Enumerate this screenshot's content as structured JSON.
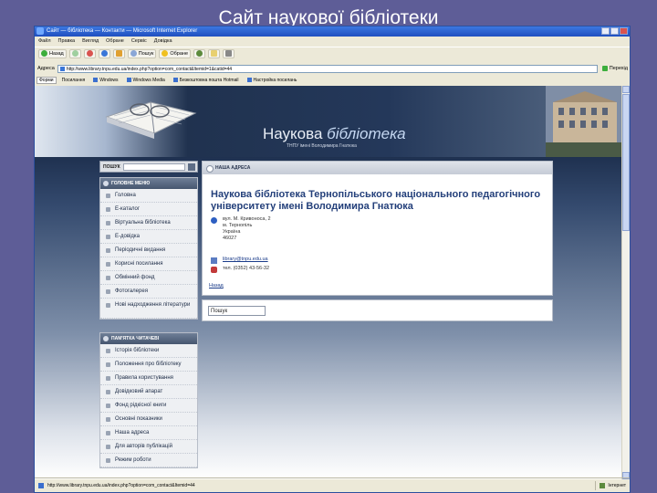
{
  "slide_title": "Сайт наукової бібліотеки",
  "browser": {
    "title": "Сайт — бібліотека — Контакти — Microsoft Internet Explorer",
    "menu": [
      "Файл",
      "Правка",
      "Вигляд",
      "Обране",
      "Сервіс",
      "Довідка"
    ],
    "toolbar": {
      "back": "Назад",
      "search": "Пошук",
      "favorites": "Обране"
    },
    "address_label": "Адреса",
    "address": "http://www.library.tnpu.edu.ua/index.php?option=com_contact&Itemid=1&catid=44",
    "go": "Перехід",
    "links": [
      "Посилання",
      "Windows",
      "Windows Media",
      "Безкоштовна пошта Hotmail",
      "Настройка посилань"
    ],
    "links_dropdown": "Форми",
    "status": "http://www.library.tnpu.edu.ua/index.php?option=com_contact&Itemid=44",
    "zone": "Інтернет"
  },
  "site": {
    "title_word1": "Наукова",
    "title_word2": "бібліотека",
    "subtitle": "ТНПУ імені Володимира Гнатюка"
  },
  "search": {
    "label": "ПОШУК"
  },
  "main_menu": {
    "heading": "ГОЛОВНЕ МЕНЮ",
    "items": [
      "Головна",
      "Е-каталог",
      "Віртуальна бібліотека",
      "Е-довідка",
      "Періодичні видання",
      "Корисні посилання",
      "Обмінний фонд",
      "Фотогалерея",
      "Нові надходження літератури"
    ]
  },
  "reader_menu": {
    "heading": "ПАМ'ЯТКА ЧИТАЧЕВІ",
    "items": [
      "Історія бібліотеки",
      "Положення про бібліотеку",
      "Правила користування",
      "Довідковий апарат",
      "Фонд рідкісної книги",
      "Основні показники",
      "Наша адреса",
      "Для авторів публікацій",
      "Режим роботи"
    ]
  },
  "contact": {
    "heading": "НАША АДРЕСА",
    "org_name": "Наукова бібліотека Тернопільського національного педагогічного університету імені Володимира Гнатюка",
    "address_lines": [
      "вул. М. Кривоноса, 2",
      "м. Тернопіль",
      "Україна",
      "46027"
    ],
    "email": "library@tnpu.edu.ua",
    "phone": "тел. (0352) 43-56-32",
    "back": "Назад"
  },
  "bottom_search": {
    "value": "Пошук"
  },
  "colors": {
    "desktop": "#5e5d97",
    "org_name": "#233f7a",
    "header_dark": "#20324f"
  }
}
